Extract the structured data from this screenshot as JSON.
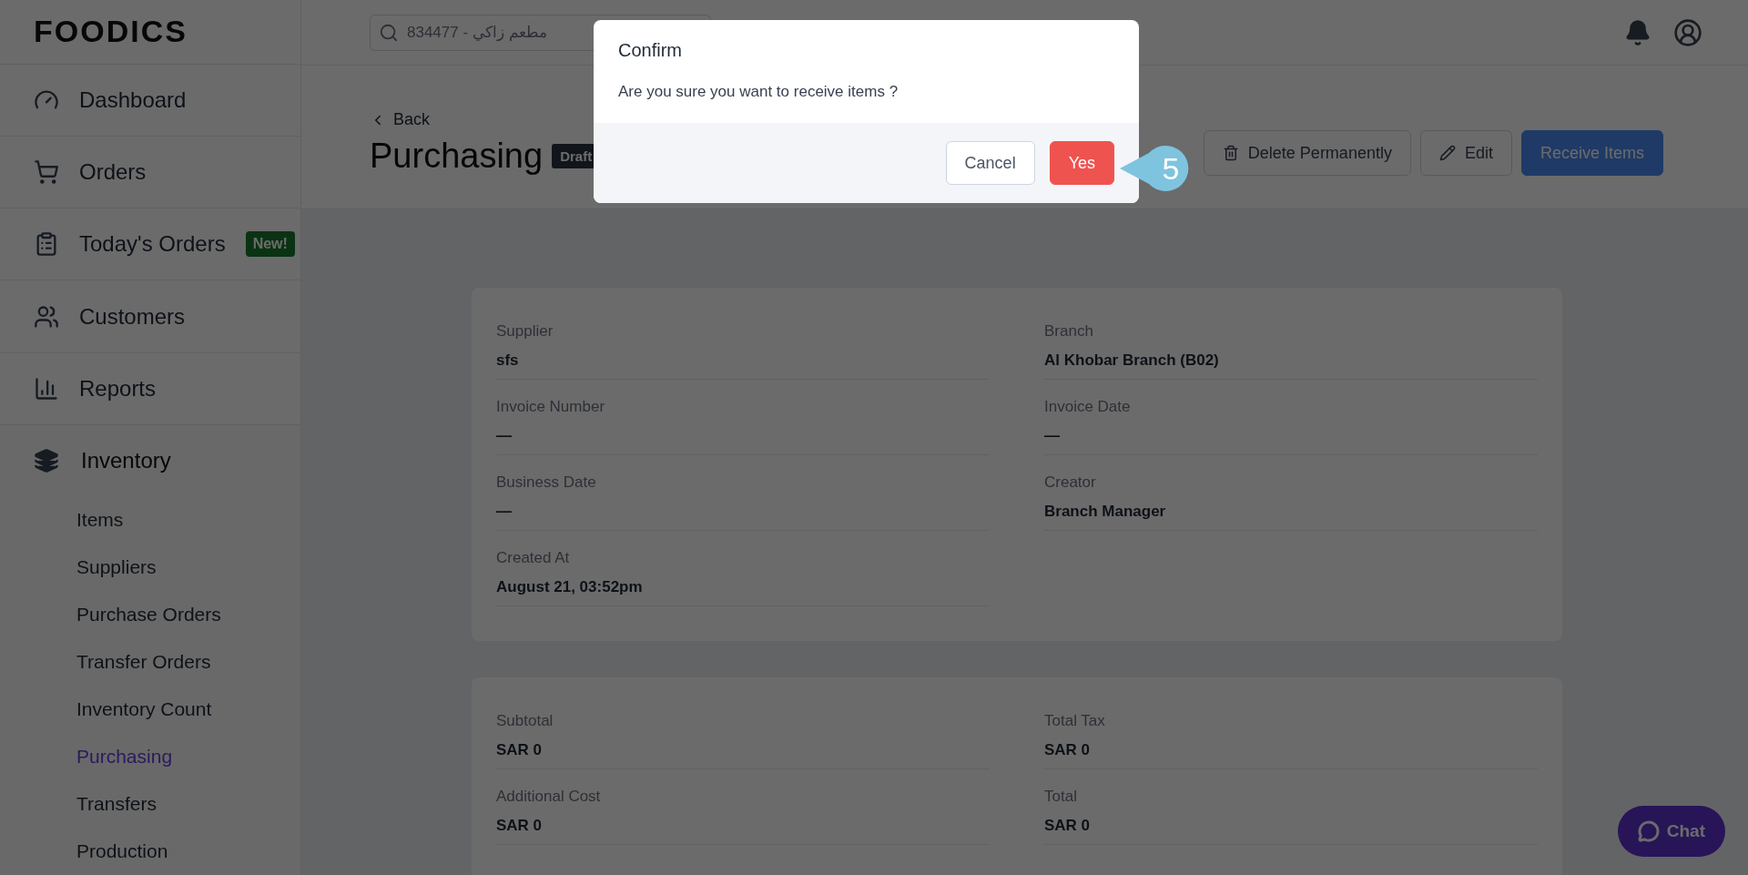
{
  "logo": "FOODICS",
  "search": {
    "placeholder": "834477 - مطعم زاكي"
  },
  "sidebar": {
    "items": [
      {
        "label": "Dashboard",
        "selected": false
      },
      {
        "label": "Orders",
        "selected": false
      },
      {
        "label": "Today's Orders",
        "selected": false,
        "badge": "New!"
      },
      {
        "label": "Customers",
        "selected": false
      },
      {
        "label": "Reports",
        "selected": false
      },
      {
        "label": "Inventory",
        "selected": false,
        "expanded": true,
        "children": [
          {
            "label": "Items",
            "selected": false
          },
          {
            "label": "Suppliers",
            "selected": false
          },
          {
            "label": "Purchase Orders",
            "selected": false
          },
          {
            "label": "Transfer Orders",
            "selected": false
          },
          {
            "label": "Inventory Count",
            "selected": false
          },
          {
            "label": "Purchasing",
            "selected": true
          },
          {
            "label": "Transfers",
            "selected": false
          },
          {
            "label": "Production",
            "selected": false
          }
        ]
      }
    ]
  },
  "page": {
    "back": "Back",
    "title": "Purchasing",
    "status": "Draft",
    "actions": [
      {
        "label": "Delete Permanently",
        "kind": "outline"
      },
      {
        "label": "Edit",
        "kind": "outline"
      },
      {
        "label": "Receive Items",
        "kind": "primary"
      }
    ]
  },
  "details": [
    {
      "label": "Supplier",
      "value": "sfs"
    },
    {
      "label": "Branch",
      "value": "Al Khobar Branch (B02)"
    },
    {
      "label": "Invoice Number",
      "value": "—"
    },
    {
      "label": "Invoice Date",
      "value": "—"
    },
    {
      "label": "Business Date",
      "value": "—"
    },
    {
      "label": "Creator",
      "value": "Branch Manager"
    },
    {
      "label": "Created At",
      "value": "August 21, 03:52pm"
    }
  ],
  "totals": [
    {
      "label": "Subtotal",
      "value": "SAR 0"
    },
    {
      "label": "Total Tax",
      "value": "SAR 0"
    },
    {
      "label": "Additional Cost",
      "value": "SAR 0"
    },
    {
      "label": "Total",
      "value": "SAR 0"
    }
  ],
  "dialog": {
    "title": "Confirm",
    "message": "Are you sure you want to receive items ?",
    "buttons": [
      {
        "label": "Cancel",
        "kind": "secondary"
      },
      {
        "label": "Yes",
        "kind": "danger"
      }
    ]
  },
  "callout": "5",
  "chat": "Chat"
}
